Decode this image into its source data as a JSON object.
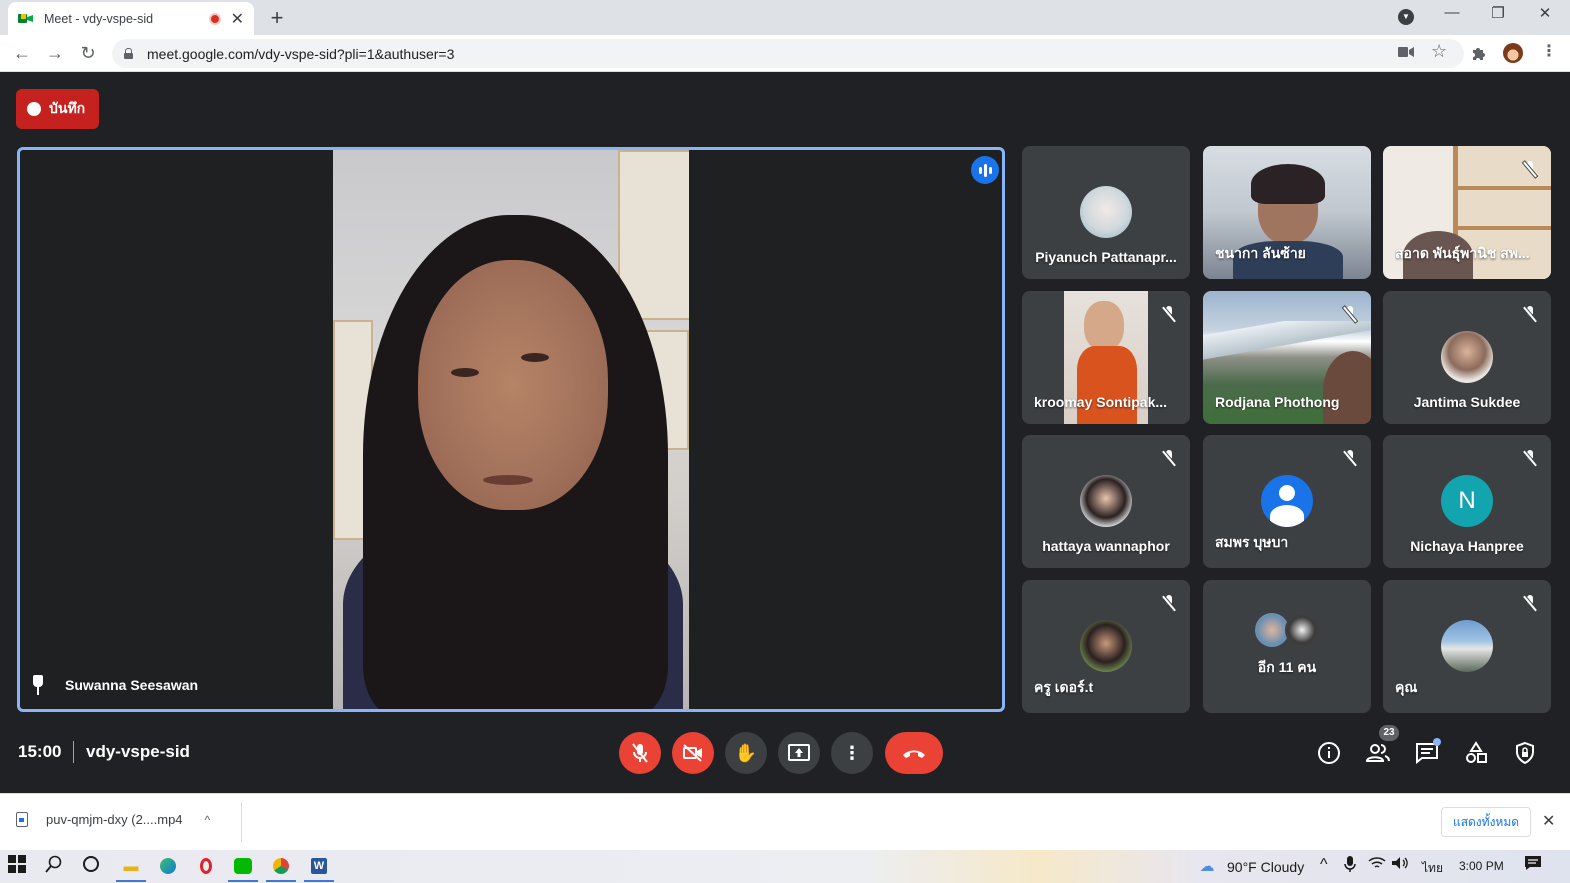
{
  "browser": {
    "tab_title": "Meet - vdy-vspe-sid",
    "tab_close": "✕",
    "new_tab": "+",
    "url": "meet.google.com/vdy-vspe-sid?pli=1&authuser=3",
    "window_minimize": "—",
    "window_restore": "❐",
    "window_close": "✕"
  },
  "meet": {
    "record_label": "บันทึก",
    "main_speaker": "Suwanna Seesawan",
    "participants": [
      {
        "name": "Piyanuch Pattanapr...",
        "muted": false,
        "type": "avatar"
      },
      {
        "name": "ชนากา ลันซ้าย",
        "muted": false,
        "type": "camera"
      },
      {
        "name": "สอาด พันธุ์พานิช สพ...",
        "muted": true,
        "type": "camera"
      },
      {
        "name": "kroomay Sontipak...",
        "muted": true,
        "type": "camera"
      },
      {
        "name": "Rodjana Phothong",
        "muted": true,
        "type": "camera"
      },
      {
        "name": "Jantima Sukdee",
        "muted": true,
        "type": "avatar"
      },
      {
        "name": "hattaya wannaphor",
        "muted": true,
        "type": "avatar"
      },
      {
        "name": "สมพร บุษบา",
        "muted": true,
        "type": "avatar"
      },
      {
        "name": "Nichaya Hanpree",
        "muted": true,
        "type": "letter",
        "letter": "N"
      },
      {
        "name": "ครู เดอร์.t",
        "muted": true,
        "type": "avatar"
      },
      {
        "name": "อีก 11 คน",
        "muted": false,
        "type": "group"
      },
      {
        "name": "คุณ",
        "muted": true,
        "type": "avatar"
      }
    ],
    "time": "15:00",
    "meeting_code": "vdy-vspe-sid",
    "people_count": "23",
    "colors": {
      "accent": "#8ab4f8",
      "danger": "#ea4335",
      "tile": "#3c4043",
      "background": "#202124"
    }
  },
  "downloads": {
    "file_name": "puv-qmjm-dxy (2....mp4",
    "show_all": "แสดงทั้งหมด"
  },
  "taskbar": {
    "weather": "90°F  Cloudy",
    "language": "ไทย",
    "clock": "3:00 PM"
  }
}
